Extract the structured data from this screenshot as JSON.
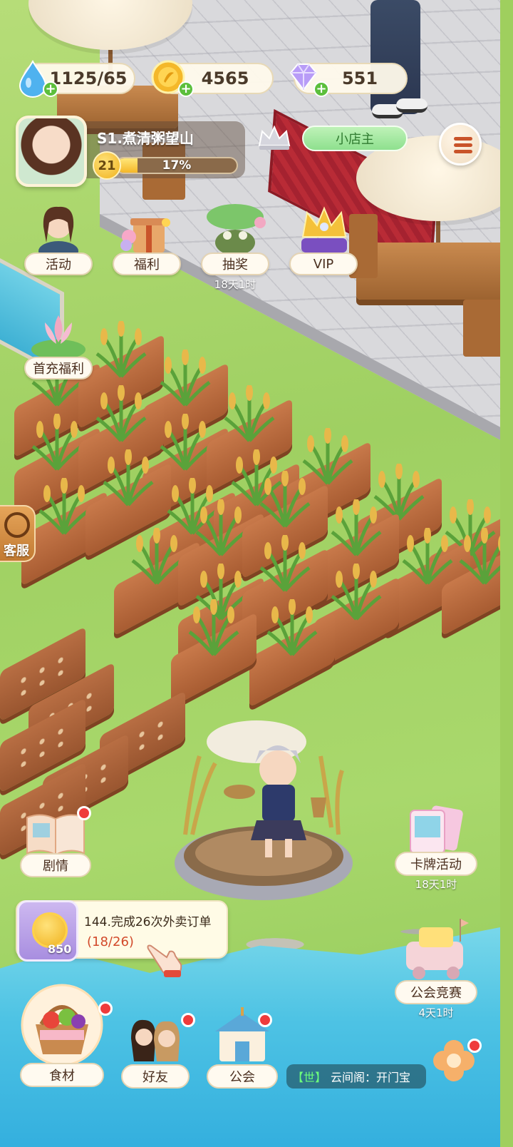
{
  "resources": {
    "water": "1125/65",
    "coins": "4565",
    "gems": "551"
  },
  "player": {
    "name": "S1.煮清粥望山",
    "level": "21",
    "xp_percent_text": "17%",
    "xp_fraction": 0.17,
    "title": "小店主"
  },
  "features": {
    "activity": "活动",
    "welfare": "福利",
    "lottery": "抽奖",
    "lottery_timer": "18天1时",
    "vip": "VIP",
    "first_recharge": "首充福利"
  },
  "service": "客服",
  "story": "剧情",
  "card_event": {
    "label": "卡牌活动",
    "timer": "18天1时"
  },
  "guild_race": {
    "label": "公会竞赛",
    "timer": "4天1时"
  },
  "quest": {
    "reward": "850",
    "text": "144.完成26次外卖订单",
    "progress": "(18/26)"
  },
  "bottom_nav": {
    "ingredients": "食材",
    "friends": "好友",
    "guild": "公会"
  },
  "chat": {
    "channel": "【世】",
    "message": "云间阁：开门宝"
  },
  "colors": {
    "grass": "#9fcf5e",
    "soil": "#b86e43",
    "accent_green": "#5cbf3c",
    "badge_red": "#ef3b3b"
  }
}
